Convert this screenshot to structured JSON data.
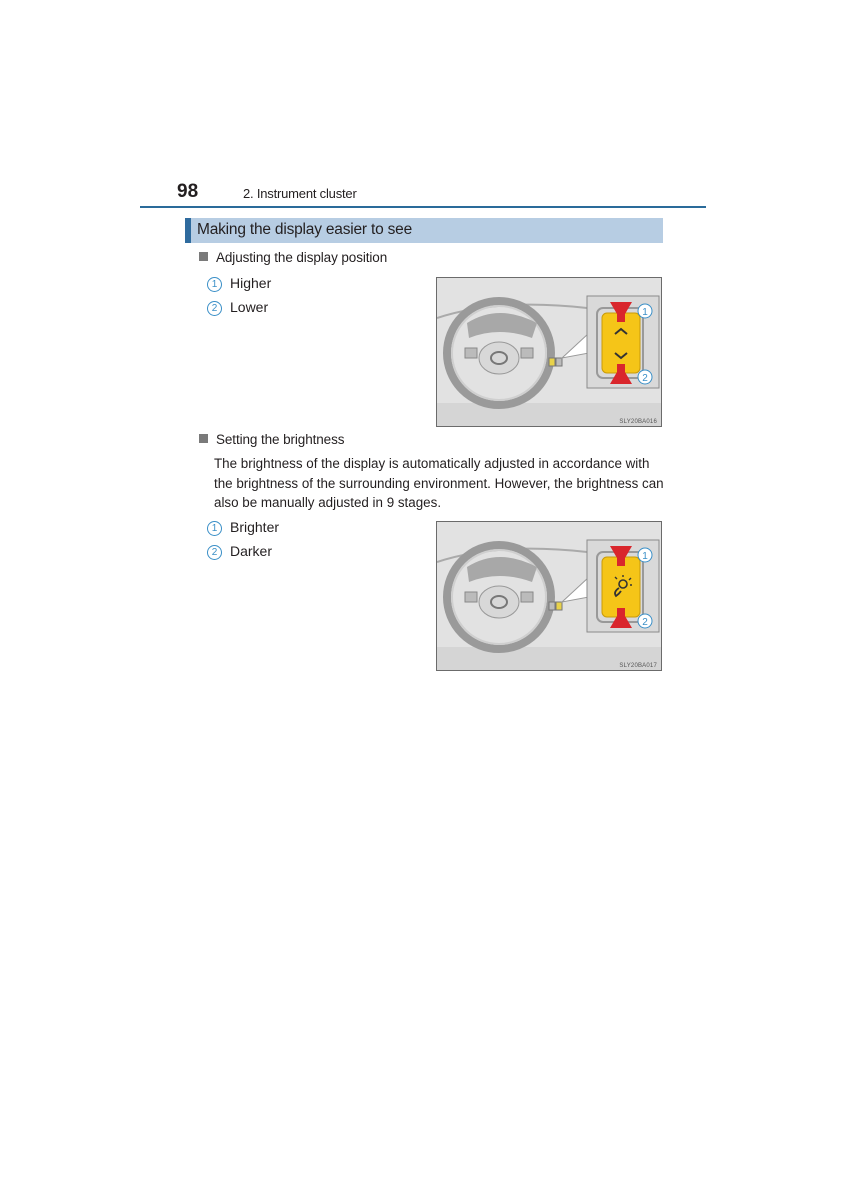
{
  "header": {
    "page_number": "98",
    "chapter": "2. Instrument cluster"
  },
  "section": {
    "title": "Making the display easier to see"
  },
  "position": {
    "heading": "Adjusting the display position",
    "items": [
      {
        "num": "1",
        "label": "Higher"
      },
      {
        "num": "2",
        "label": "Lower"
      }
    ],
    "figure": {
      "code": "SLY20BA016",
      "switch_icon_up": "chevron-up",
      "switch_icon_down": "chevron-down",
      "callouts": [
        "1",
        "2"
      ]
    }
  },
  "brightness": {
    "heading": "Setting the brightness",
    "paragraph": "The brightness of the display is automatically adjusted in accordance with the brightness of the surrounding environment. However, the brightness can also be manually adjusted in 9 stages.",
    "items": [
      {
        "num": "1",
        "label": "Brighter"
      },
      {
        "num": "2",
        "label": "Darker"
      }
    ],
    "figure": {
      "code": "SLY20BA017",
      "switch_icon": "brightness",
      "callouts": [
        "1",
        "2"
      ]
    }
  },
  "colors": {
    "accent_blue": "#2f6b9e",
    "section_bg": "#b7cde3",
    "callout_blue": "#3a8fc7",
    "arrow_red": "#d9262c",
    "switch_yellow": "#f5c518"
  }
}
